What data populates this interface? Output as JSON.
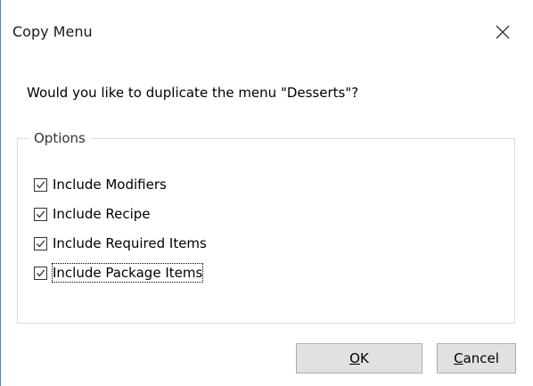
{
  "dialog": {
    "title": "Copy Menu",
    "close_icon": "close-icon",
    "question": "Would you like to duplicate the menu \"Desserts\"?"
  },
  "options": {
    "legend": "Options",
    "items": [
      {
        "label": "Include Modifiers",
        "checked": true
      },
      {
        "label": "Include Recipe",
        "checked": true
      },
      {
        "label": "Include Required Items",
        "checked": true
      },
      {
        "label": "Include Package Items",
        "checked": true,
        "focused": true
      }
    ]
  },
  "buttons": {
    "ok": {
      "mnemonic": "O",
      "rest": "K"
    },
    "cancel": {
      "mnemonic": "C",
      "rest": "ancel"
    }
  },
  "colors": {
    "window_edge": "#3a8ad6",
    "button_bg": "#e1e1e1",
    "group_border": "#dcdcdc"
  }
}
